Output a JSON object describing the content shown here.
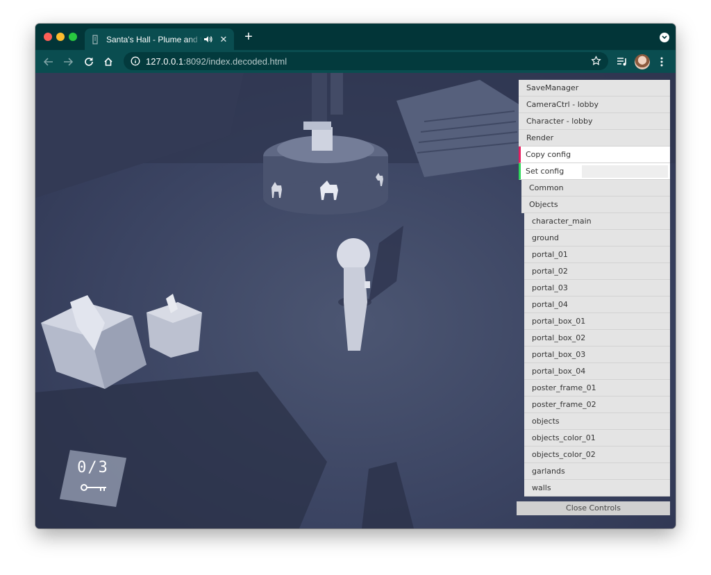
{
  "browser": {
    "tab": {
      "title": "Santa's Hall - Plume and the",
      "favicon": "page-icon",
      "audio_icon": "speaker-icon",
      "close_icon": "close-icon"
    },
    "new_tab_label": "+",
    "address": {
      "host": "127.0.0.1",
      "path": ":8092/index.decoded.html"
    }
  },
  "game": {
    "counter": "0/3",
    "counter_icon": "key-icon"
  },
  "controls": {
    "items": [
      {
        "label": "SaveManager",
        "kind": "folder"
      },
      {
        "label": "CameraCtrl - lobby",
        "kind": "folder"
      },
      {
        "label": "Character - lobby",
        "kind": "folder"
      },
      {
        "label": "Render",
        "kind": "folder"
      },
      {
        "label": "Copy config",
        "kind": "button"
      },
      {
        "label": "Set config",
        "kind": "button"
      },
      {
        "label": "Common",
        "kind": "subfolder"
      },
      {
        "label": "Objects",
        "kind": "subfolder"
      },
      {
        "label": "character_main",
        "kind": "leaf"
      },
      {
        "label": "ground",
        "kind": "leaf"
      },
      {
        "label": "portal_01",
        "kind": "leaf"
      },
      {
        "label": "portal_02",
        "kind": "leaf"
      },
      {
        "label": "portal_03",
        "kind": "leaf"
      },
      {
        "label": "portal_04",
        "kind": "leaf"
      },
      {
        "label": "portal_box_01",
        "kind": "leaf"
      },
      {
        "label": "portal_box_02",
        "kind": "leaf"
      },
      {
        "label": "portal_box_03",
        "kind": "leaf"
      },
      {
        "label": "portal_box_04",
        "kind": "leaf"
      },
      {
        "label": "poster_frame_01",
        "kind": "leaf"
      },
      {
        "label": "poster_frame_02",
        "kind": "leaf"
      },
      {
        "label": "objects",
        "kind": "leaf"
      },
      {
        "label": "objects_color_01",
        "kind": "leaf"
      },
      {
        "label": "objects_color_02",
        "kind": "leaf"
      },
      {
        "label": "garlands",
        "kind": "leaf"
      },
      {
        "label": "walls",
        "kind": "leaf"
      }
    ],
    "close_label": "Close Controls"
  },
  "colors": {
    "tab_strip": "#023538",
    "toolbar": "#0a4d50",
    "copy_config_accent": "#e61d5f",
    "set_config_accent": "#2fd65a"
  }
}
